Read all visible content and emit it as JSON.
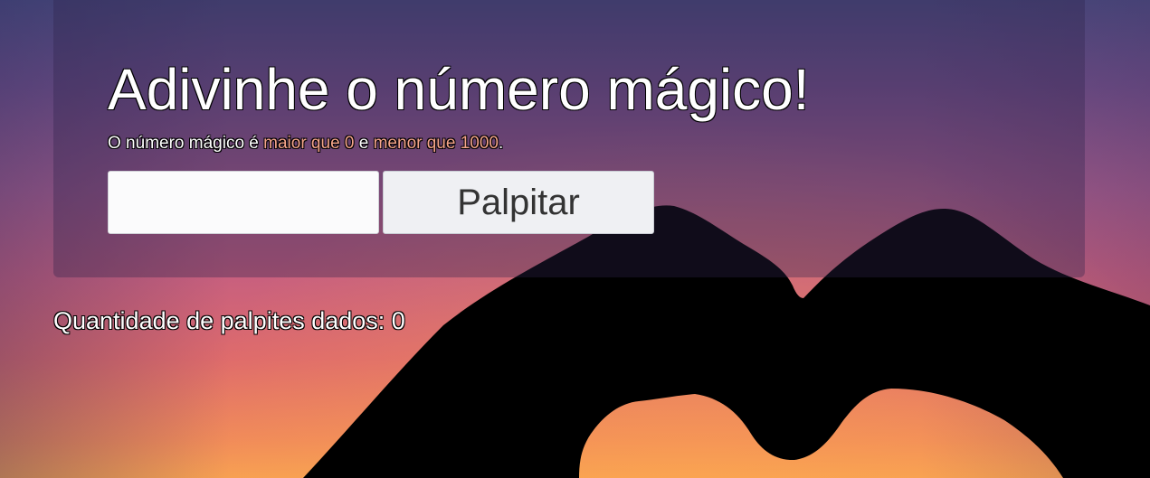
{
  "page": {
    "title": "Adivinhe o número mágico!",
    "subtitle": {
      "prefix": "O número mágico é ",
      "lower_bound": "maior que 0",
      "connector": " e ",
      "upper_bound": "menor que 1000",
      "suffix": "."
    }
  },
  "form": {
    "guess_value": "",
    "guess_placeholder": "",
    "submit_label": "Palpitar"
  },
  "status": {
    "guess_count_text": "Quantidade de palpites dados: 0"
  },
  "colors": {
    "highlight": "#f5a58a",
    "button_bg": "#eff0f3",
    "input_bg": "#fbfbfc"
  },
  "icons": {
    "background": "heart-hands-silhouette"
  }
}
